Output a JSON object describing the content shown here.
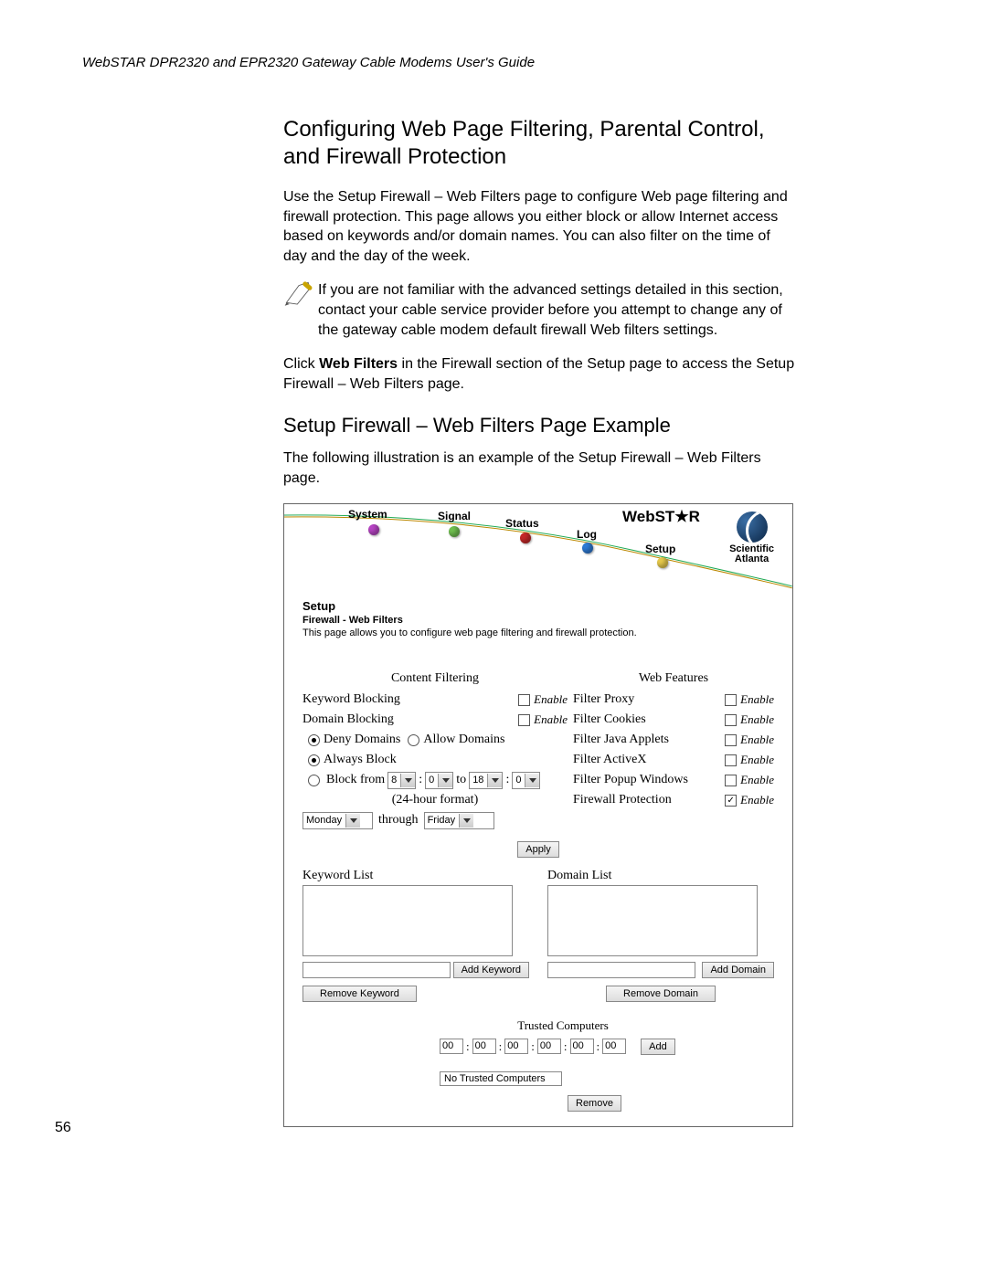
{
  "runningHeader": "WebSTAR DPR2320 and EPR2320 Gateway Cable Modems User's Guide",
  "pageNumber": "56",
  "section": {
    "title": "Configuring Web Page Filtering, Parental Control, and Firewall Protection",
    "intro": "Use the Setup Firewall – Web Filters page to configure Web page filtering and firewall protection. This page allows you either block or allow Internet access based on keywords and/or domain names. You can also filter on the time of day and the day of the week.",
    "note": "If you are not familiar with the advanced settings detailed in this section, contact your cable service provider before you attempt to change any of the gateway cable modem default firewall Web filters settings.",
    "click_pre": "Click ",
    "click_bold": "Web Filters",
    "click_post": " in the Firewall section of the Setup page to access the Setup Firewall – Web Filters page.",
    "h2": "Setup Firewall – Web Filters Page Example",
    "illus_caption": "The following illustration is an example of the Setup Firewall – Web Filters page."
  },
  "nav": {
    "system": "System",
    "signal": "Signal",
    "status": "Status",
    "log": "Log",
    "setup": "Setup",
    "brand_a": "WebST",
    "brand_b": "R",
    "sa1": "Scientific",
    "sa2": "Atlanta"
  },
  "setup": {
    "title": "Setup",
    "sub": "Firewall - Web Filters",
    "desc": "This page allows you to configure web page filtering and firewall protection."
  },
  "cf": {
    "header": "Content Filtering",
    "keyword": "Keyword Blocking",
    "domain": "Domain Blocking",
    "deny": "Deny Domains",
    "allow": "Allow Domains",
    "always": "Always Block",
    "block_from": "Block from",
    "to": "to",
    "tf_note": "(24-hour format)",
    "time_h1": "8",
    "time_m1": "0",
    "time_h2": "18",
    "time_m2": "0",
    "day1": "Monday",
    "through": "through",
    "day2": "Friday",
    "enable": "Enable"
  },
  "wf": {
    "header": "Web Features",
    "proxy": "Filter Proxy",
    "cookies": "Filter Cookies",
    "java": "Filter Java Applets",
    "activex": "Filter ActiveX",
    "popup": "Filter Popup Windows",
    "firewall": "Firewall Protection",
    "enable": "Enable"
  },
  "buttons": {
    "apply": "Apply",
    "addKeyword": "Add Keyword",
    "removeKeyword": "Remove Keyword",
    "addDomain": "Add Domain",
    "removeDomain": "Remove Domain",
    "add": "Add",
    "remove": "Remove"
  },
  "lists": {
    "keyword": "Keyword List",
    "domain": "Domain List"
  },
  "trusted": {
    "title": "Trusted Computers",
    "mac": [
      "00",
      "00",
      "00",
      "00",
      "00",
      "00"
    ],
    "none": "No Trusted Computers"
  }
}
